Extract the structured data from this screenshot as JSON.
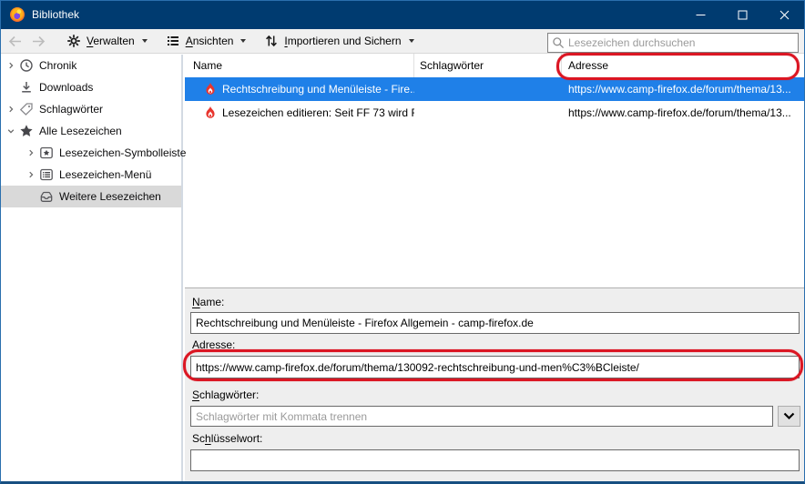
{
  "window": {
    "title": "Bibliothek"
  },
  "toolbar": {
    "menus": [
      {
        "icon": "gear-icon",
        "label_pre": "",
        "label_key": "V",
        "label_post": "erwalten"
      },
      {
        "icon": "list-icon",
        "label_pre": "",
        "label_key": "A",
        "label_post": "nsichten"
      },
      {
        "icon": "import-export-icon",
        "label_pre": "",
        "label_key": "I",
        "label_post": "mportieren und Sichern"
      }
    ],
    "search_placeholder": "Lesezeichen durchsuchen"
  },
  "sidebar": {
    "items": [
      {
        "label": "Chronik",
        "icon": "clock-icon",
        "state": "collapsed",
        "level": 0
      },
      {
        "label": "Downloads",
        "icon": "download-icon",
        "state": "none",
        "level": 0
      },
      {
        "label": "Schlagwörter",
        "icon": "tag-icon",
        "state": "collapsed",
        "level": 0
      },
      {
        "label": "Alle Lesezeichen",
        "icon": "star-icon",
        "state": "expanded",
        "level": 0
      },
      {
        "label": "Lesezeichen-Symbolleiste",
        "icon": "bookmark-toolbar-icon",
        "state": "collapsed",
        "level": 1
      },
      {
        "label": "Lesezeichen-Menü",
        "icon": "bookmark-menu-icon",
        "state": "collapsed",
        "level": 1
      },
      {
        "label": "Weitere Lesezeichen",
        "icon": "other-bookmarks-icon",
        "state": "selected",
        "level": 1
      }
    ]
  },
  "table": {
    "columns": [
      "Name",
      "Schlagwörter",
      "Adresse"
    ],
    "rows": [
      {
        "name": "Rechtschreibung und Menüleiste - Fire...",
        "tags": "",
        "url": "https://www.camp-firefox.de/forum/thema/13...",
        "selected": true
      },
      {
        "name": "Lesezeichen editieren: Seit FF 73 wird F...",
        "tags": "",
        "url": "https://www.camp-firefox.de/forum/thema/13...",
        "selected": false
      }
    ]
  },
  "details": {
    "name_label": {
      "pre": "",
      "key": "N",
      "post": "ame:"
    },
    "name_value": "Rechtschreibung und Menüleiste - Firefox Allgemein - camp-firefox.de",
    "address_label": {
      "pre": "",
      "key": "A",
      "post": "dresse:"
    },
    "address_value": "https://www.camp-firefox.de/forum/thema/130092-rechtschreibung-und-men%C3%BCleiste/",
    "tags_label": {
      "pre": "",
      "key": "S",
      "post": "chlagwörter:"
    },
    "tags_placeholder": "Schlagwörter mit Kommata trennen",
    "keyword_label": {
      "pre": "Sc",
      "key": "h",
      "post": "lüsselwort:"
    },
    "keyword_value": ""
  },
  "annotations": {
    "color": "#db1623",
    "items": [
      "adresse-column-header-highlight",
      "adresse-field-highlight"
    ]
  },
  "colors": {
    "titlebar": "#003b70",
    "selection_blue": "#1f80e8",
    "sidebar_selected": "#d9d9d9",
    "detail_pane": "#eeeeee"
  }
}
